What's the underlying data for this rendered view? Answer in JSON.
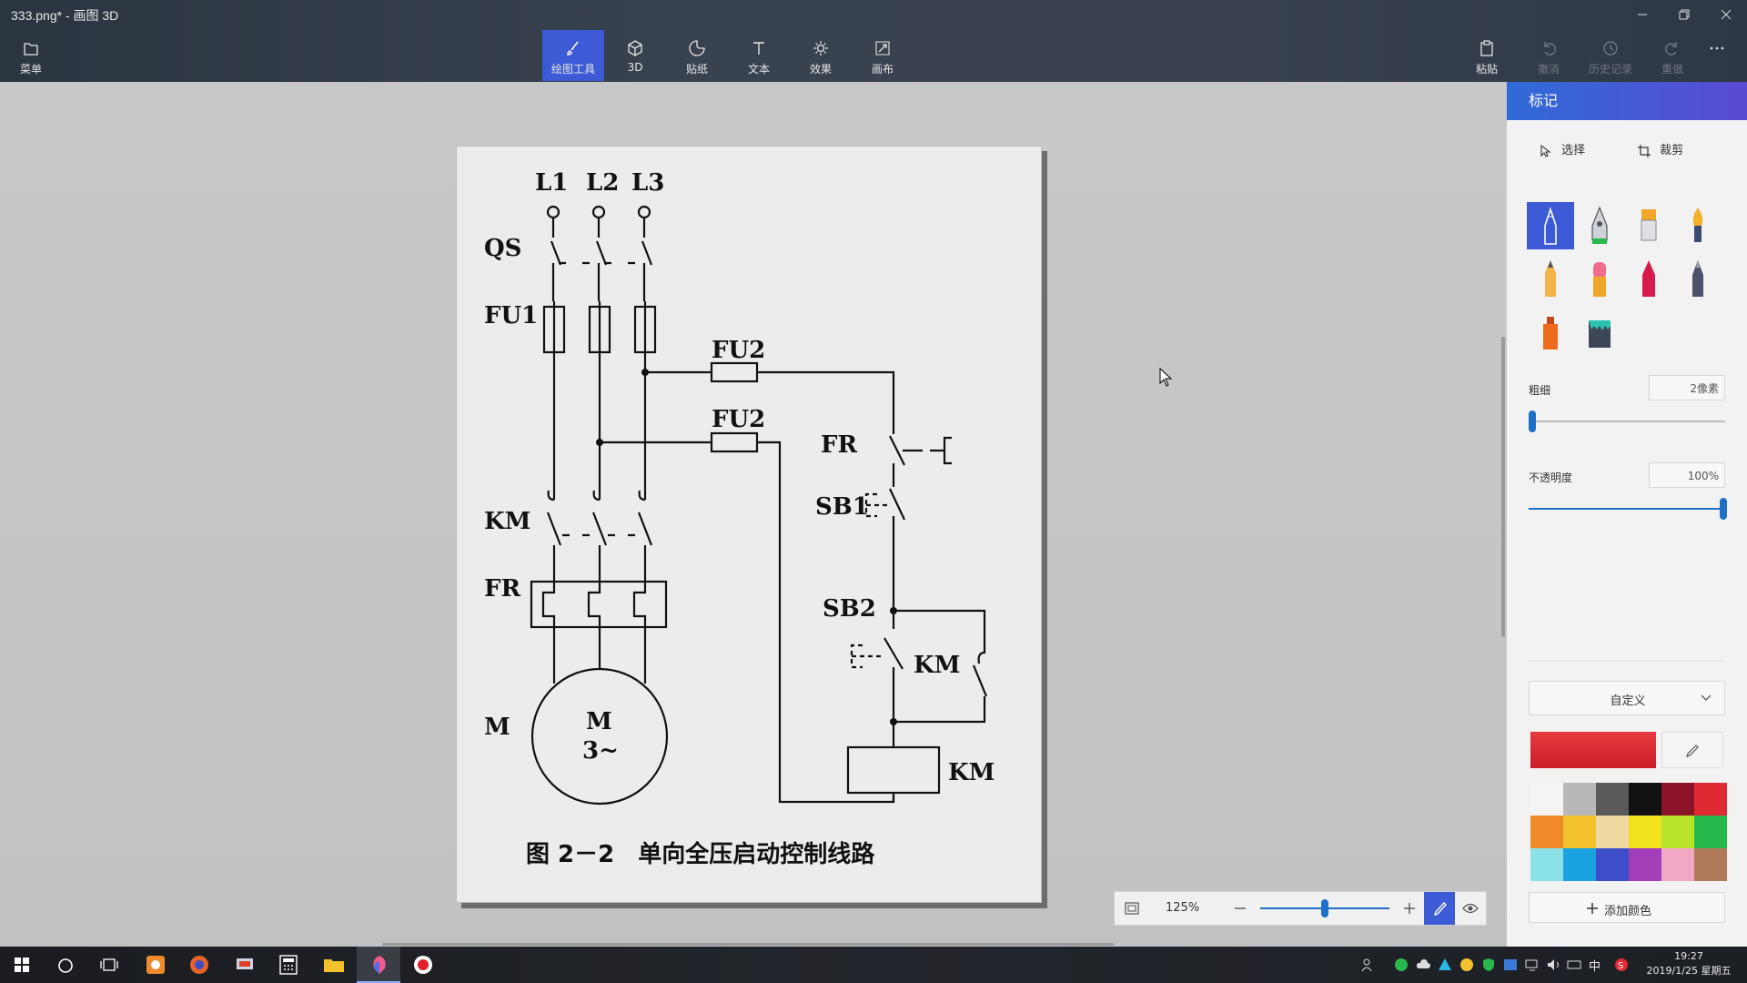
{
  "window": {
    "title": "333.png* - 画图 3D"
  },
  "toolbar": {
    "menu_label": "菜单",
    "tools": [
      "绘图工具",
      "3D",
      "贴纸",
      "文本",
      "效果",
      "画布"
    ],
    "right": [
      "粘贴",
      "撤消",
      "历史记录",
      "重做"
    ]
  },
  "panel": {
    "title": "标记",
    "select_label": "选择",
    "crop_label": "裁剪",
    "brush_icons": [
      "marker-icon",
      "calligraphy-pen-icon",
      "oil-brush-icon",
      "watercolor-icon",
      "pencil-icon",
      "eraser-icon",
      "crayon-icon",
      "pixel-pen-icon",
      "spray-can-icon",
      "fill-icon"
    ],
    "thickness_label": "粗细",
    "thickness_value": "2像素",
    "thickness_fraction": 0.02,
    "opacity_label": "不透明度",
    "opacity_value": "100%",
    "opacity_fraction": 1.0,
    "color_mode": "自定义",
    "current_color": "#e02a33",
    "palette": [
      "#f4f4f4",
      "#b8b8b8",
      "#5a5a5a",
      "#111111",
      "#8b1428",
      "#e02a33",
      "#ef8a2a",
      "#f2c12c",
      "#efd9a0",
      "#f0e21c",
      "#b8e42a",
      "#27b84c",
      "#8ae2e8",
      "#1aa2e0",
      "#3e4ec8",
      "#a23fb8",
      "#f0a8c4",
      "#b07a5a"
    ],
    "add_color_label": "添加颜色"
  },
  "zoom": {
    "value": "125%",
    "fraction": 0.5
  },
  "diagram": {
    "phases": [
      "L1",
      "L2",
      "L3"
    ],
    "labels": {
      "qs": "QS",
      "fu1": "FU1",
      "fu2a": "FU2",
      "fu2b": "FU2",
      "km_main": "KM",
      "fr_main": "FR",
      "motor": "M",
      "motor_inner1": "M",
      "motor_inner2": "3~",
      "fr_ctrl": "FR",
      "sb1": "SB1",
      "sb2": "SB2",
      "km_aux": "KM",
      "km_coil": "KM"
    },
    "caption": "图 2－2　单向全压启动控制线路"
  },
  "taskbar": {
    "time": "19:27",
    "date": "2019/1/25 星期五",
    "ime": "中"
  }
}
